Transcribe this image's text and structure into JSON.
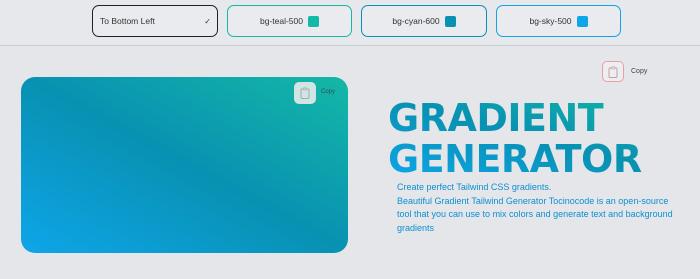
{
  "toolbar": {
    "direction_label": "To Bottom Left",
    "direction_chevron": "✓",
    "colors": [
      {
        "label": "bg-teal-500",
        "hex": "#14b8a6"
      },
      {
        "label": "bg-cyan-600",
        "hex": "#0891b2"
      },
      {
        "label": "bg-sky-500",
        "hex": "#0ea5e9"
      }
    ]
  },
  "preview": {
    "copy_label": "Copy",
    "copy_icon": "clipboard-icon"
  },
  "outer_copy": {
    "copy_label": "Copy",
    "copy_icon": "clipboard-icon"
  },
  "hero": {
    "title_line1": "GRADIENT",
    "title_line2": "GENERATOR",
    "tagline": "Create perfect Tailwind CSS gradients.",
    "description": "Beautiful Gradient Tailwind Generator Tocinocode is an open-source tool that you can use to mix colors and generate text and background gradients"
  }
}
